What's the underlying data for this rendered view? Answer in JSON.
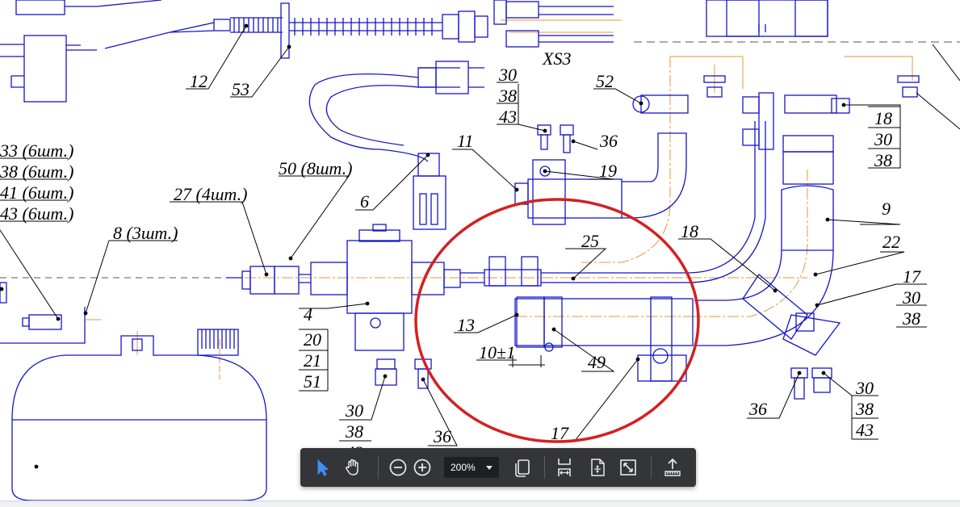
{
  "labels": {
    "l12": "12",
    "l53": "53",
    "lxs3": "XS3",
    "l30a": "30",
    "l38a": "38",
    "l43a": "43",
    "l52": "52",
    "l36a": "36",
    "l11": "11",
    "l19": "19",
    "l33": "33 (6шт.)",
    "l38b": "38 (6шт.)",
    "l41": "41 (6шт.)",
    "l43b": "43 (6шт.)",
    "l50": "50 (8шт.)",
    "l27": "27 (4шт.)",
    "l8": "8 (3шт.)",
    "l6": "6",
    "l25": "25",
    "l18a": "18",
    "l9": "9",
    "l22": "22",
    "l17a": "17",
    "l30b": "30",
    "l38c": "38",
    "l18b": "18",
    "l30c": "30",
    "l38d": "38",
    "l4": "4",
    "l20": "20",
    "l21": "21",
    "l51": "51",
    "l13": "13",
    "l10": "10±1",
    "l49": "49",
    "l30d": "30",
    "l38e": "38",
    "l43c": "43",
    "l36b": "36",
    "l17b": "17",
    "l36c": "36",
    "l30e": "30",
    "l38f": "38",
    "l43d": "43"
  },
  "colors": {
    "line": "#1515c8",
    "axis": "#e8953a",
    "highlight": "#d42020",
    "toolbar_bg": "#333538"
  },
  "toolbar": {
    "zoom_value": "200%",
    "tools": [
      "select-arrow-icon",
      "hand-icon",
      "zoom-out-icon",
      "zoom-in-icon",
      "page-display-icon",
      "fit-width-icon",
      "fit-page-icon",
      "full-screen-icon",
      "share-upload-icon"
    ]
  }
}
